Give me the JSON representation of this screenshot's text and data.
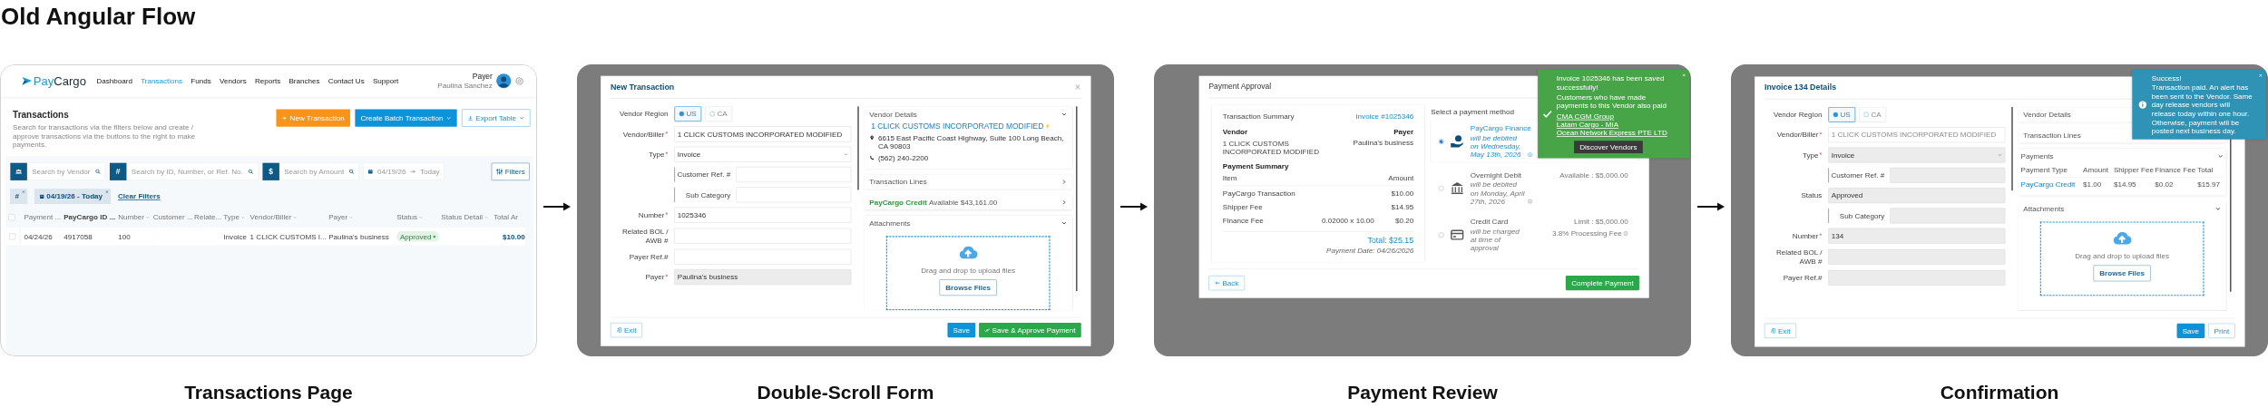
{
  "title": "Old Angular Flow",
  "steps": [
    {
      "kind": "transactions",
      "caption": "Transactions Page",
      "screen": {
        "logo": [
          "Pay",
          "Cargo"
        ],
        "nav": [
          {
            "label": "Dashboard",
            "selected": false
          },
          {
            "label": "Transactions",
            "selected": true
          },
          {
            "label": "Funds",
            "selected": false
          },
          {
            "label": "Vendors",
            "selected": false
          },
          {
            "label": "Reports",
            "selected": false
          },
          {
            "label": "Branches",
            "selected": false
          },
          {
            "label": "Contact Us",
            "selected": false
          },
          {
            "label": "Support",
            "selected": false
          }
        ],
        "user": {
          "role": "Payer",
          "name": "Paulina Sanchez"
        },
        "heading": "Transactions",
        "description": "Search for transactions via the filters below and create / approve transactions via the buttons to the right to make payments.",
        "actions": [
          {
            "kind": "primary",
            "label": "New Transaction"
          },
          {
            "kind": "batch",
            "label": "Create Batch Transaction"
          },
          {
            "kind": "export",
            "label": "Export Table"
          }
        ],
        "searches": [
          {
            "kind": "vendor",
            "placeholder": "Search by Vendor"
          },
          {
            "kind": "id",
            "prefix": "#",
            "placeholder": "Search by ID, Number, or Ref. No."
          },
          {
            "kind": "amount",
            "prefix": "$",
            "placeholder": "Search by Amount"
          }
        ],
        "date_range": {
          "from": "04/19/26",
          "to": "Today"
        },
        "filters_button": "Filters",
        "chips": [
          {
            "kind": "text",
            "label": "#"
          },
          {
            "kind": "date",
            "label": "04/19/26 - Today"
          }
        ],
        "clear_filters": "Clear Filters",
        "table": {
          "all_checked": false,
          "columns": [
            {
              "label": "Payment ...",
              "sortable": false
            },
            {
              "label": "PayCargo ID ...",
              "sortable": false,
              "kind": "strong"
            },
            {
              "label": "Number",
              "sortable": true
            },
            {
              "label": "Customer ...",
              "sortable": false
            },
            {
              "label": "Relate...",
              "sortable": false
            },
            {
              "label": "Type",
              "sortable": true
            },
            {
              "label": "Vendor/Biller",
              "sortable": true
            },
            {
              "label": "Payer",
              "sortable": true
            },
            {
              "label": "Status",
              "sortable": true,
              "kind": "status"
            },
            {
              "label": "Status Detail",
              "sortable": true
            },
            {
              "label": "Total Ar",
              "sortable": false,
              "kind": "amount"
            }
          ],
          "rows": [
            {
              "checked": false,
              "column_1": "04/24/26",
              "column_2": "4917058",
              "column_3": "100",
              "column_6": "Invoice",
              "column_7": "1 CLICK CUSTOMS I...",
              "column_8": "Paulina's business",
              "column_9": "Approved",
              "column_11": "$10.00"
            }
          ]
        }
      }
    },
    {
      "kind": "form",
      "caption": "Double-Scroll Form",
      "screen": {
        "title": "New Transaction",
        "closable": true,
        "fields": [
          {
            "kind": "region",
            "label": "Vendor Region",
            "options": [
              {
                "label": "US",
                "selected": true
              },
              {
                "label": "CA",
                "selected": false
              }
            ]
          },
          {
            "kind": "vendor",
            "label": "Vendor/Biller",
            "required": true,
            "value": "1 CLICK CUSTOMS INCORPORATED MODIFIED",
            "disabled": false
          },
          {
            "kind": "select",
            "label": "Type",
            "required": true,
            "value": "Invoice",
            "disabled": false
          },
          {
            "kind": "sub",
            "label": "Customer Ref. #",
            "disabled": false
          },
          {
            "kind": "sub",
            "label": "Sub Category",
            "disabled": false
          },
          {
            "kind": "input",
            "label": "Number",
            "required": true,
            "value": "1025346",
            "disabled": false
          },
          {
            "kind": "input",
            "label": "Related BOL / AWB #",
            "required": false,
            "disabled": false
          },
          {
            "kind": "input",
            "label": "Payer Ref.#",
            "required": false,
            "disabled": false
          },
          {
            "kind": "input",
            "label": "Payer",
            "required": true,
            "value": "Paulina's business",
            "disabled": true
          }
        ],
        "cards": [
          {
            "kind": "vendor",
            "title": "Vendor Details",
            "expanded": true,
            "name": "1 CLICK CUSTOMS INCORPORATED MODIFIED",
            "address": "6615 East Pacific Coast Highway, Suite 100 Long Beach, CA 90803",
            "phone": "(562) 240-2200"
          },
          {
            "kind": "section",
            "title": "Transaction Lines",
            "expanded": false
          },
          {
            "kind": "credit",
            "title": "PayCargo Credit",
            "text": "Available $43,161.00",
            "expanded": false
          },
          {
            "kind": "attachments",
            "title": "Attachments",
            "expanded": true,
            "hint": "Drag and drop to upload files",
            "button": "Browse Files"
          }
        ],
        "buttons": [
          {
            "kind": "exit",
            "label": "Exit"
          },
          {
            "kind": "save",
            "label": "Save"
          },
          {
            "kind": "approve",
            "label": "Save & Approve Payment"
          }
        ]
      }
    },
    {
      "kind": "review",
      "caption": "Payment Review",
      "screen": {
        "title": "Payment Approval",
        "summary": {
          "heading": "Transaction Summary",
          "invoice": "Invoice #1025346",
          "vendor_label": "Vendor",
          "payer_label": "Payer",
          "vendor": "1 CLICK CUSTOMS INCORPORATED MODIFIED",
          "payer": "Paulina's business",
          "section": "Payment Summary",
          "item_header": "Item",
          "amount_header": "Amount",
          "lines": [
            {
              "item": "PayCargo Transaction",
              "amount": "$10.00"
            },
            {
              "item": "Shipper Fee",
              "amount": "$14.95"
            },
            {
              "item": "Finance Fee",
              "detail": "0.02000 x 10.00",
              "amount": "$0.20"
            }
          ],
          "total": "Total: $25.15",
          "payment_date": "Payment Date: 04/26/2026"
        },
        "methods_heading": "Select a payment method",
        "methods": [
          {
            "kind": "finance",
            "name": "PayCargo Finance",
            "note": "will be debited on Wednesday, May 13th, 2026",
            "selected": true
          },
          {
            "kind": "bank",
            "name": "Overnight Debit",
            "note": "will be debited on Monday, April 27th, 2026",
            "limit": "Available : $5,000.00",
            "selected": false
          },
          {
            "kind": "card",
            "name": "Credit Card",
            "note": "will be charged at time of approval",
            "limit": "Limit : $5,000.00",
            "fee": "3.8% Processing Fee",
            "selected": false
          }
        ],
        "back": "Back",
        "complete": "Complete Payment",
        "toast": {
          "kind": "success",
          "title": "Invoice 1025346 has been saved successfully!",
          "message": "Customers who have made payments to this Vendor also paid",
          "links": [
            "CMA CGM Group",
            "Latam Cargo - MIA",
            "Ocean Network Express PTE LTD"
          ],
          "button": "Discover Vendors"
        }
      }
    },
    {
      "kind": "details",
      "caption": "Confirmation",
      "screen": {
        "title": "Invoice 134 Details",
        "closable": false,
        "fields": [
          {
            "kind": "region",
            "label": "Vendor Region",
            "options": [
              {
                "label": "US",
                "selected": true
              },
              {
                "label": "CA",
                "selected": false
              }
            ]
          },
          {
            "kind": "vendor",
            "label": "Vendor/Biller",
            "required": true,
            "value": "1 CLICK CUSTOMS INCORPORATED MODIFIED",
            "disabled": true
          },
          {
            "kind": "select",
            "label": "Type",
            "required": true,
            "value": "Invoice",
            "disabled": true
          },
          {
            "kind": "sub",
            "label": "Customer Ref. #",
            "disabled": true
          },
          {
            "kind": "input",
            "label": "Status",
            "required": false,
            "value": "Approved",
            "disabled": true
          },
          {
            "kind": "sub",
            "label": "Sub Category",
            "disabled": true
          },
          {
            "kind": "input",
            "label": "Number",
            "required": true,
            "value": "134",
            "disabled": true
          },
          {
            "kind": "input",
            "label": "Related BOL / AWB #",
            "required": false,
            "disabled": true
          },
          {
            "kind": "input",
            "label": "Payer Ref.#",
            "required": false,
            "disabled": true
          }
        ],
        "cards": [
          {
            "kind": "section",
            "title": "Vendor Details"
          },
          {
            "kind": "section",
            "title": "Transaction Lines"
          },
          {
            "kind": "payments",
            "title": "Payments",
            "expanded": true,
            "columns": [
              "Payment Type",
              "Amount",
              "Shipper Fee",
              "Finance Fee",
              "Total"
            ],
            "rows": [
              [
                "PayCargo Credit",
                "$1.00",
                "$14.95",
                "$0.02",
                "$15.97"
              ]
            ]
          },
          {
            "kind": "attachments",
            "title": "Attachments",
            "expanded": true,
            "hint": "Drag and drop to upload files",
            "button": "Browse Files"
          }
        ],
        "buttons": [
          {
            "kind": "exit",
            "label": "Exit"
          },
          {
            "kind": "save",
            "label": "Save"
          },
          {
            "kind": "print",
            "label": "Print"
          }
        ],
        "toast": {
          "kind": "info",
          "title": "Success!",
          "message": "Transaction paid. An alert has been sent to the Vendor. Same day release vendors will release today within one hour. Otherwise, payment will be posted next business day."
        }
      }
    }
  ]
}
